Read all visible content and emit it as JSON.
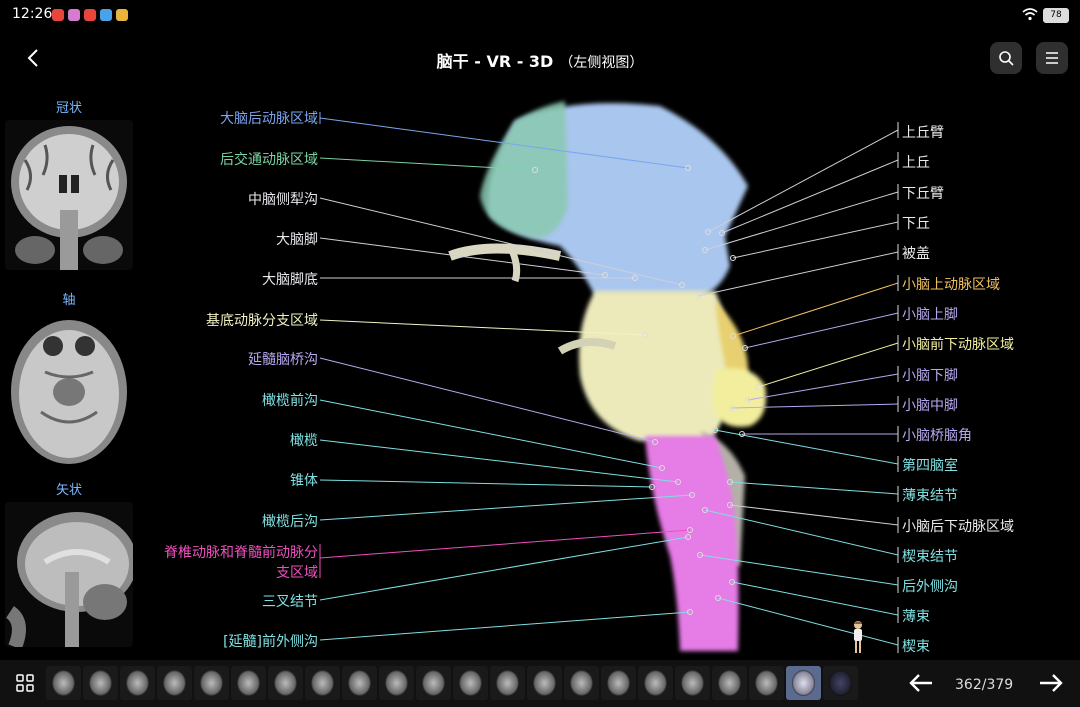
{
  "status": {
    "time": "12:26",
    "battery": "78"
  },
  "header": {
    "title": "脑干 - VR - 3D",
    "subtitle": "（左侧视图）"
  },
  "thumbs": {
    "coronal": "冠状",
    "axial": "轴",
    "sagittal": "矢状"
  },
  "left_labels": [
    {
      "text": "大脑后动脉区域",
      "color": "#7ba5ee"
    },
    {
      "text": "后交通动脉区域",
      "color": "#7cd3a4"
    },
    {
      "text": "中脑侧犁沟",
      "color": "#e8e8ee"
    },
    {
      "text": "大脑脚",
      "color": "#e8e8ee"
    },
    {
      "text": "大脑脚底",
      "color": "#e8e8ee"
    },
    {
      "text": "基底动脉分支区域",
      "color": "#f2f2c4"
    },
    {
      "text": "延髓脑桥沟",
      "color": "#b8a8f0"
    },
    {
      "text": "橄榄前沟",
      "color": "#7fe0e2"
    },
    {
      "text": "橄榄",
      "color": "#7fe0e2"
    },
    {
      "text": "锥体",
      "color": "#7fe0e2"
    },
    {
      "text": "橄榄后沟",
      "color": "#7fe0e2"
    },
    {
      "text": "脊椎动脉和脊髓前动脉分",
      "color": "#ef4fbe"
    },
    {
      "text": "支区域",
      "color": "#ef4fbe"
    },
    {
      "text": "三叉结节",
      "color": "#7fe0e2"
    },
    {
      "text": "[延髓]前外侧沟",
      "color": "#7fe0e2"
    }
  ],
  "right_labels": [
    {
      "text": "上丘臂",
      "color": "#ececec"
    },
    {
      "text": "上丘",
      "color": "#ececec"
    },
    {
      "text": "下丘臂",
      "color": "#ececec"
    },
    {
      "text": "下丘",
      "color": "#ececec"
    },
    {
      "text": "被盖",
      "color": "#ececec"
    },
    {
      "text": "小脑上动脉区域",
      "color": "#f0c060"
    },
    {
      "text": "小脑上脚",
      "color": "#b8a8f0"
    },
    {
      "text": "小脑前下动脉区域",
      "color": "#f2efa0"
    },
    {
      "text": "小脑下脚",
      "color": "#b8a8f0"
    },
    {
      "text": "小脑中脚",
      "color": "#b8a8f0"
    },
    {
      "text": "小脑桥脑角",
      "color": "#b8a8f0"
    },
    {
      "text": "第四脑室",
      "color": "#7fe0e2"
    },
    {
      "text": "薄束结节",
      "color": "#7fe0e2"
    },
    {
      "text": "小脑后下动脉区域",
      "color": "#ececec"
    },
    {
      "text": "楔束结节",
      "color": "#7fe0e2"
    },
    {
      "text": "后外侧沟",
      "color": "#7fe0e2"
    },
    {
      "text": "薄束",
      "color": "#7fe0e2"
    },
    {
      "text": "楔束",
      "color": "#7fe0e2"
    }
  ],
  "footer": {
    "page": "362/379"
  }
}
